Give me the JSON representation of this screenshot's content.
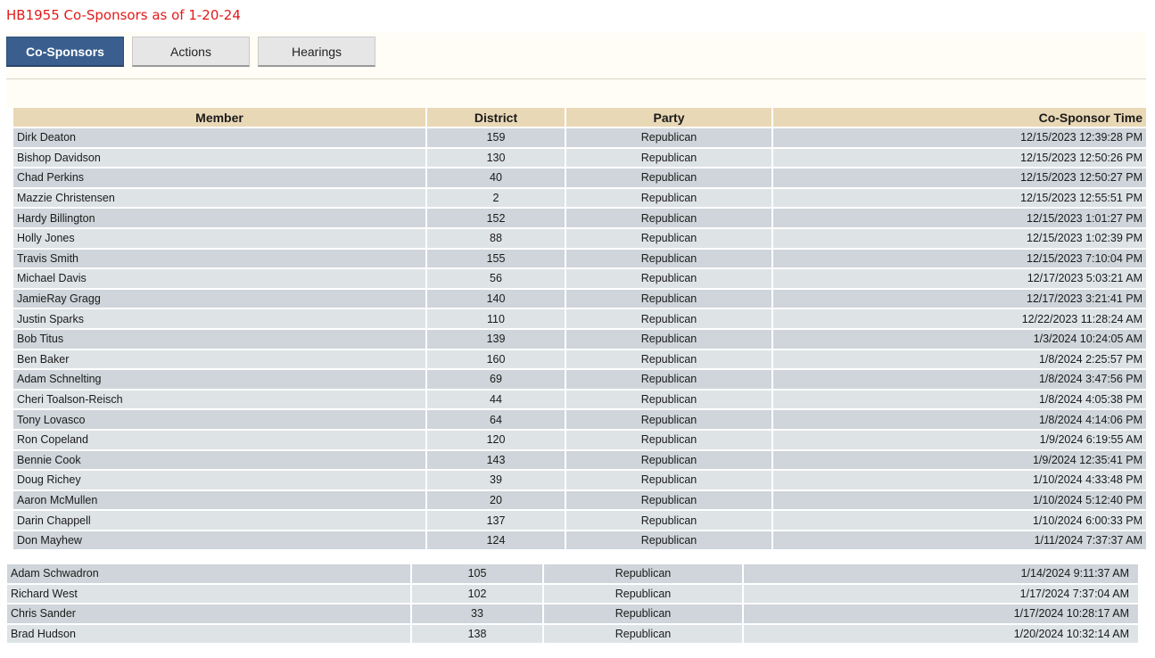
{
  "page": {
    "title": "HB1955 Co-Sponsors as of 1-20-24"
  },
  "tabs": [
    {
      "label": "Co-Sponsors",
      "active": true
    },
    {
      "label": "Actions",
      "active": false
    },
    {
      "label": "Hearings",
      "active": false
    }
  ],
  "table": {
    "headers": [
      "Member",
      "District",
      "Party",
      "Co-Sponsor Time"
    ],
    "rows": [
      [
        "Dirk Deaton",
        "159",
        "Republican",
        "12/15/2023 12:39:28 PM"
      ],
      [
        "Bishop Davidson",
        "130",
        "Republican",
        "12/15/2023 12:50:26 PM"
      ],
      [
        "Chad Perkins",
        "40",
        "Republican",
        "12/15/2023 12:50:27 PM"
      ],
      [
        "Mazzie Christensen",
        "2",
        "Republican",
        "12/15/2023 12:55:51 PM"
      ],
      [
        "Hardy Billington",
        "152",
        "Republican",
        "12/15/2023 1:01:27 PM"
      ],
      [
        "Holly Jones",
        "88",
        "Republican",
        "12/15/2023 1:02:39 PM"
      ],
      [
        "Travis Smith",
        "155",
        "Republican",
        "12/15/2023 7:10:04 PM"
      ],
      [
        "Michael Davis",
        "56",
        "Republican",
        "12/17/2023 5:03:21 AM"
      ],
      [
        "JamieRay Gragg",
        "140",
        "Republican",
        "12/17/2023 3:21:41 PM"
      ],
      [
        "Justin Sparks",
        "110",
        "Republican",
        "12/22/2023 11:28:24 AM"
      ],
      [
        "Bob Titus",
        "139",
        "Republican",
        "1/3/2024 10:24:05 AM"
      ],
      [
        "Ben Baker",
        "160",
        "Republican",
        "1/8/2024 2:25:57 PM"
      ],
      [
        "Adam Schnelting",
        "69",
        "Republican",
        "1/8/2024 3:47:56 PM"
      ],
      [
        "Cheri Toalson-Reisch",
        "44",
        "Republican",
        "1/8/2024 4:05:38 PM"
      ],
      [
        "Tony Lovasco",
        "64",
        "Republican",
        "1/8/2024 4:14:06 PM"
      ],
      [
        "Ron Copeland",
        "120",
        "Republican",
        "1/9/2024 6:19:55 AM"
      ],
      [
        "Bennie Cook",
        "143",
        "Republican",
        "1/9/2024 12:35:41 PM"
      ],
      [
        "Doug Richey",
        "39",
        "Republican",
        "1/10/2024 4:33:48 PM"
      ],
      [
        "Aaron McMullen",
        "20",
        "Republican",
        "1/10/2024 5:12:40 PM"
      ],
      [
        "Darin Chappell",
        "137",
        "Republican",
        "1/10/2024 6:00:33 PM"
      ],
      [
        "Don Mayhew",
        "124",
        "Republican",
        "1/11/2024 7:37:37 AM"
      ]
    ]
  },
  "extra_rows": [
    [
      "Adam Schwadron",
      "105",
      "Republican",
      "1/14/2024 9:11:37 AM"
    ],
    [
      "Richard West",
      "102",
      "Republican",
      "1/17/2024 7:37:04 AM"
    ],
    [
      "Chris Sander",
      "33",
      "Republican",
      "1/17/2024 10:28:17 AM"
    ],
    [
      "Brad Hudson",
      "138",
      "Republican",
      "1/20/2024 10:32:14 AM"
    ]
  ]
}
